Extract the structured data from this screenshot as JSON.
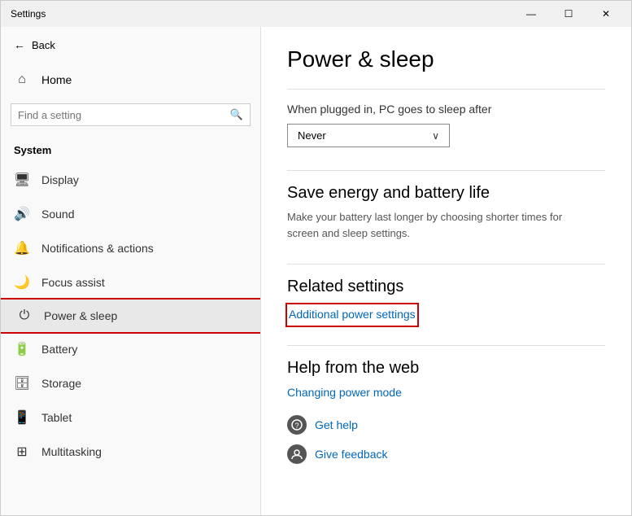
{
  "titlebar": {
    "title": "Settings",
    "minimize": "—",
    "maximize": "☐",
    "close": "✕"
  },
  "sidebar": {
    "back_label": "Back",
    "home_label": "Home",
    "search_placeholder": "Find a setting",
    "section_label": "System",
    "nav_items": [
      {
        "id": "display",
        "label": "Display",
        "icon": "🖥"
      },
      {
        "id": "sound",
        "label": "Sound",
        "icon": "🔊"
      },
      {
        "id": "notifications",
        "label": "Notifications & actions",
        "icon": "🔔"
      },
      {
        "id": "focus",
        "label": "Focus assist",
        "icon": "🌙"
      },
      {
        "id": "power",
        "label": "Power & sleep",
        "icon": "⏻",
        "active": true
      },
      {
        "id": "battery",
        "label": "Battery",
        "icon": "🔋"
      },
      {
        "id": "storage",
        "label": "Storage",
        "icon": "💾"
      },
      {
        "id": "tablet",
        "label": "Tablet",
        "icon": "📱"
      },
      {
        "id": "multitasking",
        "label": "Multitasking",
        "icon": "⊞"
      }
    ]
  },
  "main": {
    "page_title": "Power & sleep",
    "sleep_section_label": "When plugged in, PC goes to sleep after",
    "sleep_dropdown_value": "Never",
    "save_energy_title": "Save energy and battery life",
    "save_energy_desc": "Make your battery last longer by choosing shorter times for screen and sleep settings.",
    "related_settings_title": "Related settings",
    "additional_power_link": "Additional power settings",
    "help_title": "Help from the web",
    "changing_power_link": "Changing power mode",
    "get_help_label": "Get help",
    "give_feedback_label": "Give feedback"
  }
}
